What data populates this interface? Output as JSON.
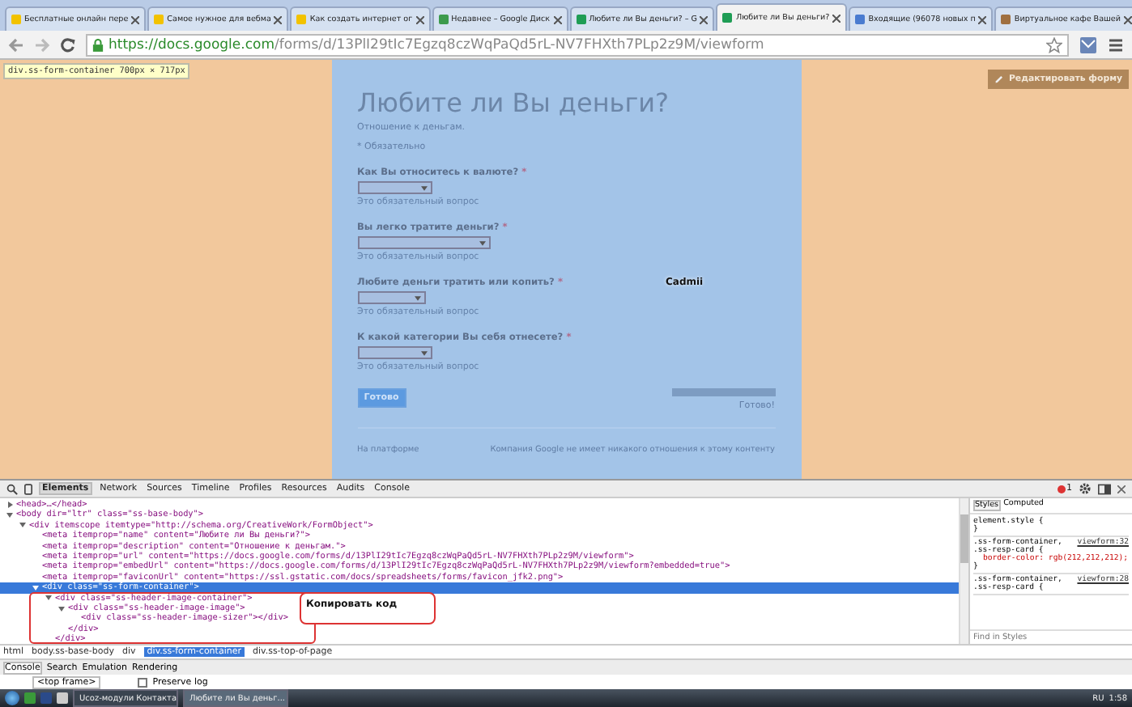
{
  "browser": {
    "tabs": [
      {
        "title": "Бесплатные онлайн пере",
        "selected": false,
        "color": "#f2c200"
      },
      {
        "title": "Самое нужное для вебма",
        "selected": false,
        "color": "#f2c200"
      },
      {
        "title": "Как создать интернет ог",
        "selected": false,
        "color": "#f2c200"
      },
      {
        "title": "Недавнее – Google Диск",
        "selected": false,
        "color": "#3c9a4c"
      },
      {
        "title": "Любите ли Вы деньги? – G",
        "selected": false,
        "color": "#1f9d55"
      },
      {
        "title": "Любите ли Вы деньги?",
        "selected": true,
        "color": "#1f9d55"
      },
      {
        "title": "Входящие (96078 новых п",
        "selected": false,
        "color": "#4a7cd0"
      },
      {
        "title": "Виртуальное кафе Вашей",
        "selected": false,
        "color": "#a07040"
      }
    ],
    "url_host": "https://docs.google.com",
    "url_path": "/forms/d/13PlI29tIc7Egzq8czWqPaQd5rL-NV7FHXth7PLp2z9M/viewform"
  },
  "page": {
    "inspect_tooltip": {
      "selector": "div.ss-form-container",
      "size": "700px × 717px"
    },
    "edit_button": "Редактировать форму",
    "form": {
      "title": "Любите ли Вы деньги?",
      "description": "Отношение к деньгам.",
      "required_note": "* Обязательно",
      "questions": [
        {
          "label": "Как Вы относитесь к валюте?",
          "required_mark": "*",
          "hint": "Это обязательный вопрос"
        },
        {
          "label": "Вы легко тратите деньги?",
          "required_mark": "*",
          "hint": "Это обязательный вопрос"
        },
        {
          "label": "Любите деньги тратить или копить?",
          "required_mark": "*",
          "hint": "Это обязательный вопрос"
        },
        {
          "label": "К какой категории Вы себя отнесете?",
          "required_mark": "*",
          "hint": "Это обязательный вопрос"
        }
      ],
      "submit": "Готово",
      "progress": {
        "level": 1,
        "label": "Готово!"
      },
      "footer_left": "На платформе",
      "footer_right": "Компания Google не имеет никакого отношения к этому контенту"
    },
    "overlay_label": "Cadmii"
  },
  "devtools": {
    "panels": [
      {
        "label": "Elements",
        "selected": true
      },
      {
        "label": "Network",
        "selected": false
      },
      {
        "label": "Sources",
        "selected": false
      },
      {
        "label": "Timeline",
        "selected": false
      },
      {
        "label": "Profiles",
        "selected": false
      },
      {
        "label": "Resources",
        "selected": false
      },
      {
        "label": "Audits",
        "selected": false
      },
      {
        "label": "Console",
        "selected": false
      }
    ],
    "error_count": "1",
    "dom_tree": [
      {
        "text": "<head>…</head>",
        "expanded": false,
        "selected": false
      },
      {
        "text": "<body dir=\"ltr\" class=\"ss-base-body\">",
        "expanded": true,
        "selected": false,
        "children": [
          {
            "text": "<div itemscope itemtype=\"http://schema.org/CreativeWork/FormObject\">",
            "expanded": true,
            "selected": false,
            "children": [
              {
                "text": "<meta itemprop=\"name\" content=\"Любите ли Вы деньги?\">",
                "selected": false
              },
              {
                "text": "<meta itemprop=\"description\" content=\"Отношение к деньгам.\">",
                "selected": false
              },
              {
                "text": "<meta itemprop=\"url\" content=\"https://docs.google.com/forms/d/13PlI29tIc7Egzq8czWqPaQd5rL-NV7FHXth7PLp2z9M/viewform\">",
                "selected": false
              },
              {
                "text": "<meta itemprop=\"embedUrl\" content=\"https://docs.google.com/forms/d/13PlI29tIc7Egzq8czWqPaQd5rL-NV7FHXth7PLp2z9M/viewform?embedded=true\">",
                "selected": false
              },
              {
                "text": "<meta itemprop=\"faviconUrl\" content=\"https://ssl.gstatic.com/docs/spreadsheets/forms/favicon_jfk2.png\">",
                "selected": false
              },
              {
                "text": "<div class=\"ss-form-container\">",
                "expanded": true,
                "selected": true,
                "children": [
                  {
                    "text": "<div class=\"ss-header-image-container\">",
                    "expanded": true,
                    "selected": false,
                    "children": [
                      {
                        "text": "<div class=\"ss-header-image-image\">",
                        "expanded": true,
                        "selected": false,
                        "children": [
                          {
                            "text": "<div class=\"ss-header-image-sizer\"></div>",
                            "selected": false
                          }
                        ]
                      },
                      {
                        "text": "</div>",
                        "selected": false
                      }
                    ]
                  },
                  {
                    "text": "</div>",
                    "selected": false
                  }
                ]
              }
            ]
          }
        ]
      }
    ],
    "callout": "Копировать код",
    "breadcrumbs": [
      {
        "label": "html",
        "selected": false
      },
      {
        "label": "body.ss-base-body",
        "selected": false
      },
      {
        "label": "div",
        "selected": false
      },
      {
        "label": "div.ss-form-container",
        "selected": true
      },
      {
        "label": "div.ss-top-of-page",
        "selected": false
      }
    ],
    "styles_tabs": [
      {
        "label": "Styles",
        "selected": true
      },
      {
        "label": "Computed",
        "selected": false
      }
    ],
    "style_rules": [
      {
        "selector": "element.style {",
        "close": "}"
      },
      {
        "selector": ".ss-form-container, .ss-resp-card {",
        "source": "viewform:32",
        "declarations": [
          "border-color: rgb(212,212,212);"
        ],
        "close": "}"
      },
      {
        "selector": ".ss-form-container, .ss-resp-card {",
        "source": "viewform:28"
      }
    ],
    "styles_filter_placeholder": "Find in Styles",
    "drawer_tabs": [
      {
        "label": "Console",
        "selected": true
      },
      {
        "label": "Search",
        "selected": false
      },
      {
        "label": "Emulation",
        "selected": false
      },
      {
        "label": "Rendering",
        "selected": false
      }
    ],
    "frame_select": "<top frame>",
    "preserve_log": {
      "label": "Preserve log",
      "checked": false
    }
  },
  "taskbar": {
    "windows": [
      {
        "title": "Ucoz-модули Контакта",
        "selected": false
      },
      {
        "title": "Любите ли Вы деньг...",
        "selected": true
      }
    ],
    "language": "RU",
    "time": "1:58"
  }
}
